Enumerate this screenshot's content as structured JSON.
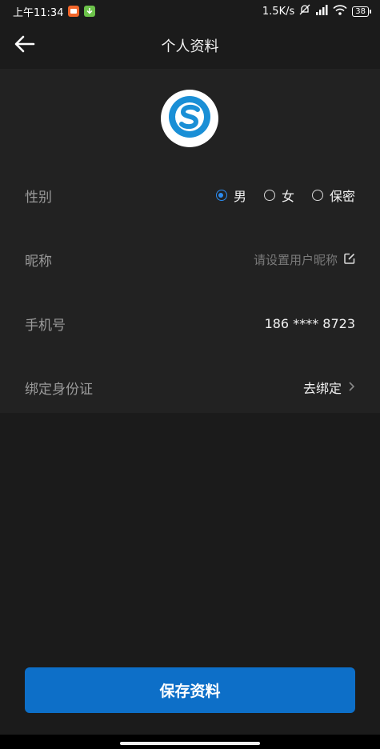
{
  "status_bar": {
    "time": "上午11:34",
    "network_speed": "1.5K/s",
    "battery": "38",
    "icons": [
      "notification-app-icon",
      "download-icon",
      "mute-icon",
      "signal-icon",
      "wifi-icon",
      "battery-icon"
    ]
  },
  "header": {
    "title": "个人资料",
    "back_icon": "arrow-left-icon"
  },
  "avatar": {
    "icon": "app-logo"
  },
  "profile": {
    "gender": {
      "label": "性别",
      "options": [
        {
          "label": "男",
          "selected": true
        },
        {
          "label": "女",
          "selected": false
        },
        {
          "label": "保密",
          "selected": false
        }
      ]
    },
    "nickname": {
      "label": "昵称",
      "placeholder": "请设置用户昵称",
      "icon": "edit-icon"
    },
    "phone": {
      "label": "手机号",
      "value": "186 **** 8723"
    },
    "id_binding": {
      "label": "绑定身份证",
      "action": "去绑定",
      "icon": "chevron-right-icon"
    }
  },
  "footer": {
    "save_label": "保存资料"
  },
  "colors": {
    "accent": "#2d8cf0",
    "button": "#0d6fc8",
    "background": "#1b1b1b",
    "section": "#222222"
  }
}
